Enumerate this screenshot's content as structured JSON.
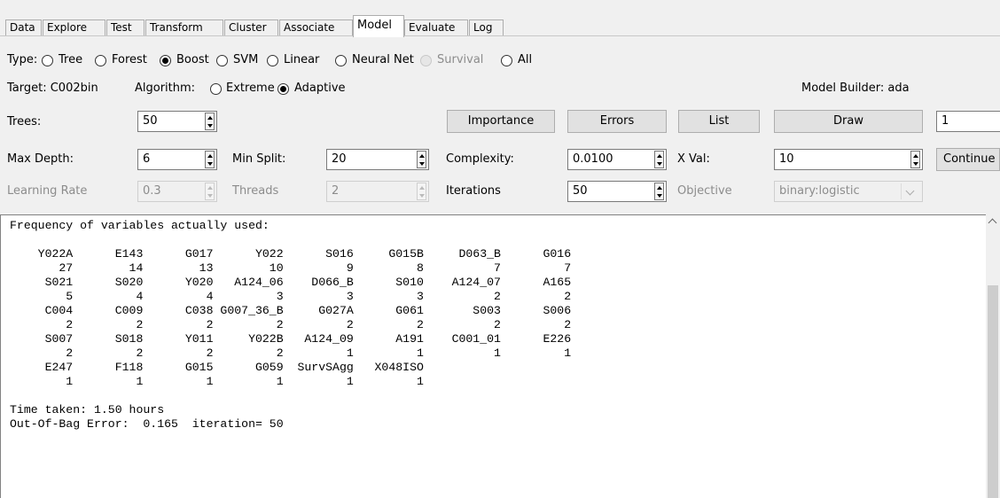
{
  "tabs": [
    "Data",
    "Explore",
    "Test",
    "Transform",
    "Cluster",
    "Associate",
    "Model",
    "Evaluate",
    "Log"
  ],
  "active_tab": "Model",
  "type_row": {
    "label": "Type:",
    "options": [
      "Tree",
      "Forest",
      "Boost",
      "SVM",
      "Linear",
      "Neural Net",
      "Survival",
      "All"
    ],
    "selected": "Boost",
    "disabled": [
      "Survival"
    ]
  },
  "target_row": {
    "target": "Target: C002bin",
    "algorithm_label": "Algorithm:",
    "algorithms": [
      "Extreme",
      "Adaptive"
    ],
    "selected": "Adaptive",
    "model_builder": "Model Builder:  ada"
  },
  "trees_row": {
    "trees_label": "Trees:",
    "trees_value": "50",
    "importance": "Importance",
    "errors": "Errors",
    "list": "List",
    "draw": "Draw",
    "draw_value": "1"
  },
  "depth_row": {
    "max_depth_label": "Max Depth:",
    "max_depth_value": "6",
    "min_split_label": "Min Split:",
    "min_split_value": "20",
    "complexity_label": "Complexity:",
    "complexity_value": "0.0100",
    "xval_label": "X Val:",
    "xval_value": "10",
    "continue": "Continue"
  },
  "rate_row": {
    "learning_rate_label": "Learning Rate",
    "learning_rate_value": "0.3",
    "threads_label": "Threads",
    "threads_value": "2",
    "iterations_label": "Iterations",
    "iterations_value": "50",
    "objective_label": "Objective",
    "objective_value": "binary:logistic"
  },
  "output_text": "Frequency of variables actually used:\n\n    Y022A      E143      G017      Y022      S016     G015B     D063_B      G016\n       27        14        13        10         9         8          7         7\n     S021      S020      Y020   A124_06    D066_B      S010    A124_07      A165\n        5         4         4         3         3         3          2         2\n     C004      C009      C038 G007_36_B     G027A      G061       S003      S006\n        2         2         2         2         2         2          2         2\n     S007      S018      Y011     Y022B   A124_09      A191    C001_01      E226\n        2         2         2         2         1         1          1         1\n     E247      F118      G015      G059  SurvSAgg   X048ISO\n        1         1         1         1         1         1\n\nTime taken: 1.50 hours\nOut-Of-Bag Error:  0.165  iteration= 50"
}
